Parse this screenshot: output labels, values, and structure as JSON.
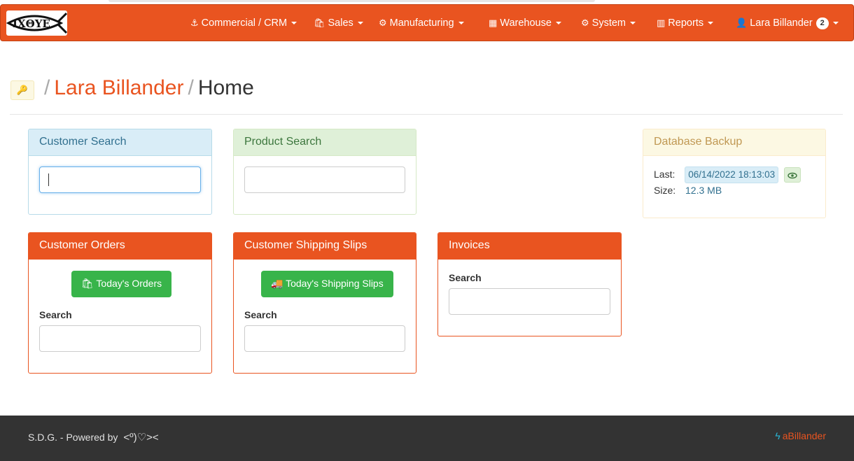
{
  "navbar": {
    "logo_text": "IXΘYE",
    "menus": [
      {
        "label": "Commercial / CRM",
        "icon": "anchor-icon"
      },
      {
        "label": "Sales",
        "icon": "shopping-bag-icon"
      },
      {
        "label": "Manufacturing",
        "icon": "cogs-icon"
      },
      {
        "label": "Warehouse",
        "icon": "grid-icon"
      },
      {
        "label": "System",
        "icon": "gears-icon"
      },
      {
        "label": "Reports",
        "icon": "bar-chart-icon"
      }
    ],
    "user": {
      "label": "Lara Billander",
      "badge": "2",
      "icon": "user-icon"
    },
    "accent": "#e95420"
  },
  "breadcrumb": {
    "icon": "key-icon",
    "user": "Lara Billander",
    "current": "Home",
    "separator": "/"
  },
  "panels": {
    "customer_search": {
      "title": "Customer Search",
      "value": "",
      "placeholder": ""
    },
    "product_search": {
      "title": "Product Search",
      "value": "",
      "placeholder": ""
    },
    "database_backup": {
      "title": "Database Backup",
      "last_label": "Last:",
      "last_value": "06/14/2022 18:13:03",
      "size_label": "Size:",
      "size_value": "12.3 MB"
    },
    "customer_orders": {
      "title": "Customer Orders",
      "button": "Today's Orders",
      "search_label": "Search"
    },
    "shipping_slips": {
      "title": "Customer Shipping Slips",
      "button": "Today's Shipping Slips",
      "search_label": "Search"
    },
    "invoices": {
      "title": "Invoices",
      "search_label": "Search"
    }
  },
  "footer": {
    "left": "S.D.G. - Powered by",
    "fish": "<º)♡><",
    "right": "aBillander"
  }
}
